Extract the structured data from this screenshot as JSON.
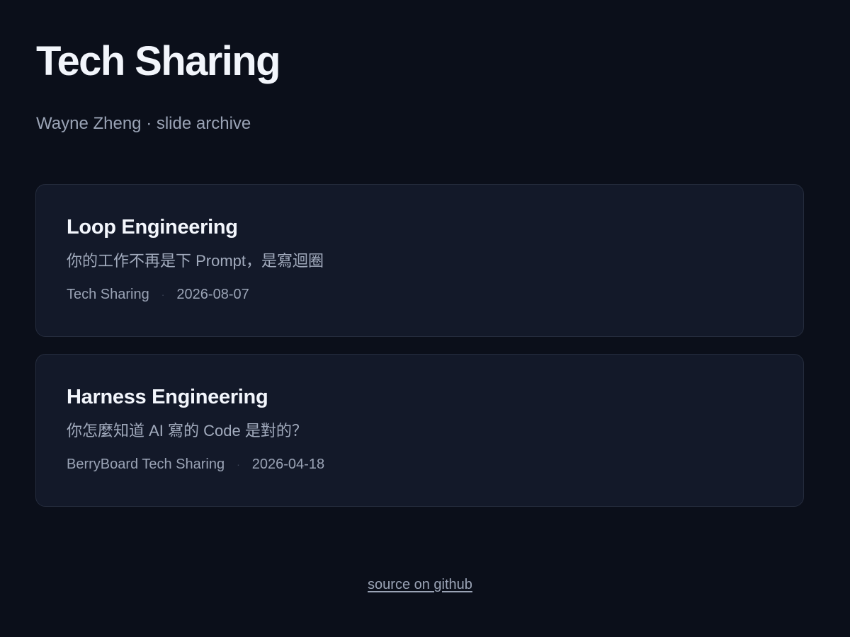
{
  "header": {
    "title": "Tech Sharing",
    "subtitle": "Wayne Zheng · slide archive"
  },
  "slides": [
    {
      "title": "Loop Engineering",
      "description": "你的工作不再是下 Prompt，是寫迴圈",
      "event": "Tech Sharing",
      "separator": "·",
      "date": "2026-08-07"
    },
    {
      "title": "Harness Engineering",
      "description": "你怎麼知道 AI 寫的 Code 是對的？",
      "event": "BerryBoard Tech Sharing",
      "separator": "·",
      "date": "2026-04-18"
    }
  ],
  "footer": {
    "link_label": "source on github"
  },
  "colors": {
    "background": "#0b0f1a",
    "card_background": "#131929",
    "card_border": "#252c3d",
    "title_text": "#f2f5fb",
    "muted_text": "#9aa3b5"
  }
}
